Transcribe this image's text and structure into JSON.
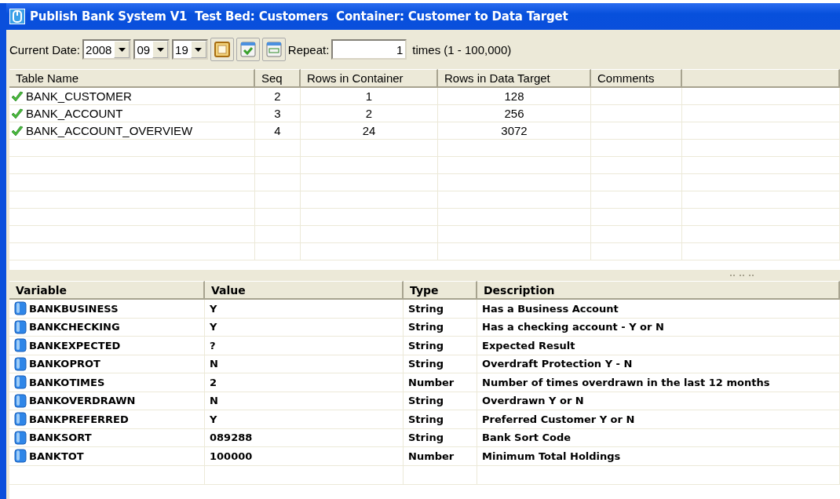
{
  "window": {
    "title": "Publish Bank System V1  Test Bed: Customers  Container: Customer to Data Target"
  },
  "toolbar": {
    "date_label": "Current Date:",
    "year": "2008",
    "month": "09",
    "day": "19",
    "repeat_label": "Repeat:",
    "repeat_value": "1",
    "repeat_hint": "times (1 - 100,000)"
  },
  "tables_grid": {
    "columns": [
      "Table Name",
      "Seq",
      "Rows in Container",
      "Rows in Data Target",
      "Comments"
    ],
    "rows": [
      {
        "table_name": "BANK_CUSTOMER",
        "seq": "2",
        "rows_in_container": "1",
        "rows_in_data_target": "128",
        "valid": true
      },
      {
        "table_name": "BANK_ACCOUNT",
        "seq": "3",
        "rows_in_container": "2",
        "rows_in_data_target": "256",
        "valid": true
      },
      {
        "table_name": "BANK_ACCOUNT_OVERVIEW",
        "seq": "4",
        "rows_in_container": "24",
        "rows_in_data_target": "3072",
        "valid": true
      }
    ]
  },
  "variables_grid": {
    "columns": [
      "Variable",
      "Value",
      "Type",
      "Description"
    ],
    "rows": [
      {
        "variable": "BANKBUSINESS",
        "value": "Y",
        "type": "String",
        "description": "Has a Business Account"
      },
      {
        "variable": "BANKCHECKING",
        "value": "Y",
        "type": "String",
        "description": "Has a checking account - Y or N"
      },
      {
        "variable": "BANKEXPECTED",
        "value": "?",
        "type": "String",
        "description": "Expected Result"
      },
      {
        "variable": "BANKOPROT",
        "value": "N",
        "type": "String",
        "description": "Overdraft Protection Y - N"
      },
      {
        "variable": "BANKOTIMES",
        "value": "2",
        "type": "Number",
        "description": "Number of times overdrawn in the last 12 months"
      },
      {
        "variable": "BANKOVERDRAWN",
        "value": "N",
        "type": "String",
        "description": "Overdrawn Y or N"
      },
      {
        "variable": "BANKPREFERRED",
        "value": "Y",
        "type": "String",
        "description": "Preferred Customer Y or N"
      },
      {
        "variable": "BANKSORT",
        "value": "089288",
        "type": "String",
        "description": "Bank Sort Code"
      },
      {
        "variable": "BANKTOT",
        "value": "100000",
        "type": "Number",
        "description": "Minimum Total Holdings"
      }
    ]
  }
}
